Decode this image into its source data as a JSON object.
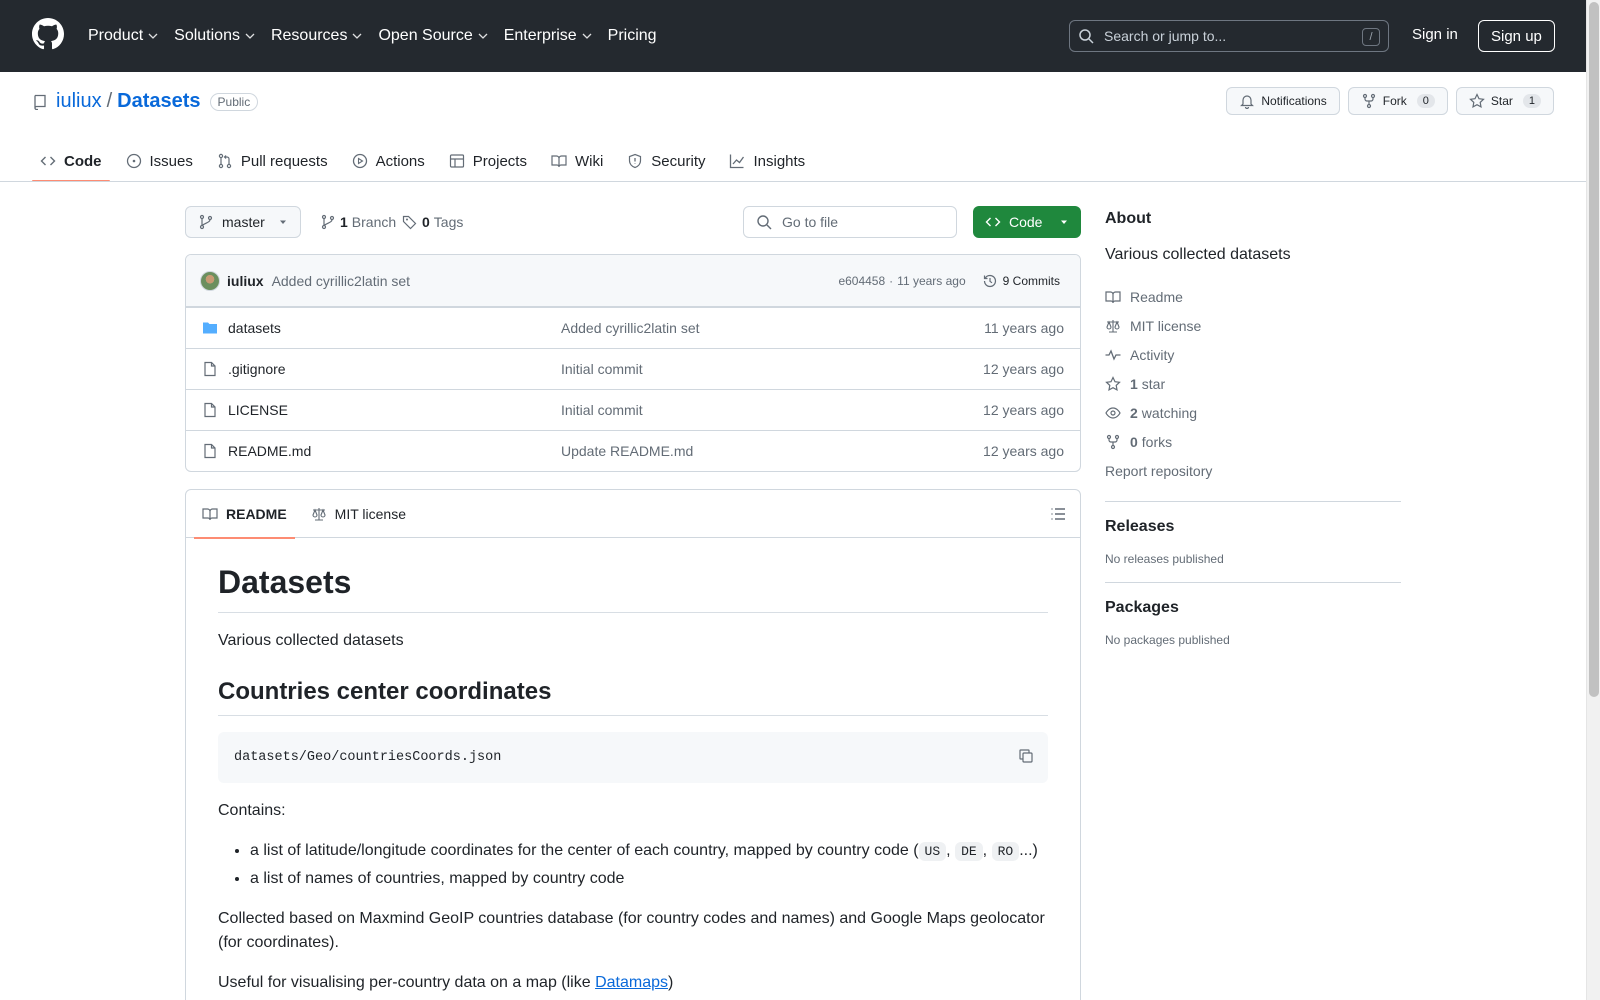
{
  "header": {
    "nav": [
      {
        "label": "Product",
        "has_menu": true
      },
      {
        "label": "Solutions",
        "has_menu": true
      },
      {
        "label": "Resources",
        "has_menu": true
      },
      {
        "label": "Open Source",
        "has_menu": true
      },
      {
        "label": "Enterprise",
        "has_menu": true
      },
      {
        "label": "Pricing",
        "has_menu": false
      }
    ],
    "search_placeholder": "Search or jump to...",
    "search_shortcut": "/",
    "sign_in": "Sign in",
    "sign_up": "Sign up"
  },
  "repo": {
    "owner": "iuliux",
    "separator": "/",
    "name": "Datasets",
    "visibility": "Public",
    "notifications_label": "Notifications",
    "fork_label": "Fork",
    "fork_count": "0",
    "star_label": "Star",
    "star_count": "1"
  },
  "tabs": [
    {
      "label": "Code",
      "icon": "code-icon",
      "active": true
    },
    {
      "label": "Issues",
      "icon": "issue-icon",
      "active": false
    },
    {
      "label": "Pull requests",
      "icon": "pull-request-icon",
      "active": false
    },
    {
      "label": "Actions",
      "icon": "play-icon",
      "active": false
    },
    {
      "label": "Projects",
      "icon": "table-icon",
      "active": false
    },
    {
      "label": "Wiki",
      "icon": "book-icon",
      "active": false
    },
    {
      "label": "Security",
      "icon": "shield-icon",
      "active": false
    },
    {
      "label": "Insights",
      "icon": "graph-icon",
      "active": false
    }
  ],
  "navigator": {
    "branch": "master",
    "branch_count": "1",
    "branch_label": "Branch",
    "tag_count": "0",
    "tag_label": "Tags",
    "goto_placeholder": "Go to file",
    "code_button": "Code"
  },
  "latest_commit": {
    "author": "iuliux",
    "message": "Added cyrillic2latin set",
    "sha": "e604458",
    "dot": "·",
    "age": "11 years ago",
    "commits_label": "9 Commits"
  },
  "files": [
    {
      "name": "datasets",
      "type": "folder",
      "message": "Added cyrillic2latin set",
      "age": "11 years ago"
    },
    {
      "name": ".gitignore",
      "type": "file",
      "message": "Initial commit",
      "age": "12 years ago"
    },
    {
      "name": "LICENSE",
      "type": "file",
      "message": "Initial commit",
      "age": "12 years ago"
    },
    {
      "name": "README.md",
      "type": "file",
      "message": "Update README.md",
      "age": "12 years ago"
    }
  ],
  "readme_tabs": [
    {
      "label": "README",
      "icon": "book-icon",
      "active": true
    },
    {
      "label": "MIT license",
      "icon": "law-icon",
      "active": false
    }
  ],
  "readme": {
    "h1": "Datasets",
    "intro": "Various collected datasets",
    "h2": "Countries center coordinates",
    "code_path": "datasets/Geo/countriesCoords.json",
    "contains_label": "Contains:",
    "bullet1_text": "a list of latitude/longitude coordinates for the center of each country, mapped by country code (",
    "bullet1_codes": [
      "US",
      "DE",
      "RO"
    ],
    "bullet1_comma": ",",
    "bullet1_end": "...)",
    "bullet2": "a list of names of countries, mapped by country code",
    "collected": "Collected based on Maxmind GeoIP countries database (for country codes and names) and Google Maps geolocator (for coordinates).",
    "useful_prefix": "Useful for visualising per-country data on a map (like ",
    "useful_link": "Datamaps",
    "useful_suffix": ")"
  },
  "sidebar": {
    "about_title": "About",
    "description": "Various collected datasets",
    "links": [
      {
        "icon": "book-icon",
        "bold": "",
        "label": "Readme"
      },
      {
        "icon": "law-icon",
        "bold": "",
        "label": "MIT license"
      },
      {
        "icon": "pulse-icon",
        "bold": "",
        "label": "Activity"
      },
      {
        "icon": "star-icon",
        "bold": "1",
        "label": "star"
      },
      {
        "icon": "eye-icon",
        "bold": "2",
        "label": "watching"
      },
      {
        "icon": "fork-icon",
        "bold": "0",
        "label": "forks"
      }
    ],
    "report": "Report repository",
    "releases_title": "Releases",
    "releases_empty": "No releases published",
    "packages_title": "Packages",
    "packages_empty": "No packages published"
  },
  "colors": {
    "header_bg": "#24292f",
    "link": "#0969da",
    "primary_button": "#1f883d",
    "active_tab_underline": "#fd8c73",
    "muted_text": "#636c76",
    "border": "#d0d7de"
  }
}
